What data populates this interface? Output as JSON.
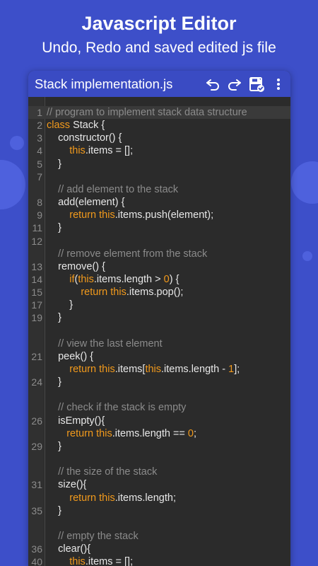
{
  "promo": {
    "title": "Javascript Editor",
    "subtitle": "Undo, Redo and saved edited js file"
  },
  "app_bar": {
    "title": "Stack implementation.js",
    "icons": [
      "undo-icon",
      "redo-icon",
      "save-icon",
      "more-vert-icon"
    ]
  },
  "colors": {
    "background": "#3d4fc9",
    "app_bar": "#3a4bc3",
    "editor_bg": "#2b2b2b",
    "keyword": "#f29a1c",
    "comment": "#8b8b8b",
    "text": "#e8e8e8",
    "line_number": "#8c8c8c"
  },
  "editor": {
    "active_line": 1,
    "lines": [
      {
        "n": "1",
        "tokens": [
          {
            "t": "// program to implement stack data structure",
            "c": "cm"
          }
        ]
      },
      {
        "n": "2",
        "tokens": [
          {
            "t": "class",
            "c": "kw"
          },
          {
            "t": " Stack {",
            "c": "pl"
          }
        ]
      },
      {
        "n": "3",
        "tokens": [
          {
            "t": "    constructor() {",
            "c": "pl"
          }
        ]
      },
      {
        "n": "4",
        "tokens": [
          {
            "t": "        ",
            "c": "pl"
          },
          {
            "t": "this",
            "c": "kw"
          },
          {
            "t": ".items = [];",
            "c": "pl"
          }
        ]
      },
      {
        "n": "5",
        "tokens": [
          {
            "t": "    }",
            "c": "pl"
          }
        ]
      },
      {
        "n": "7",
        "tokens": []
      },
      {
        "n": "",
        "tokens": [
          {
            "t": "    // add element to the stack",
            "c": "cm"
          }
        ]
      },
      {
        "n": "8",
        "tokens": [
          {
            "t": "    add(element) {",
            "c": "pl"
          }
        ]
      },
      {
        "n": "9",
        "tokens": [
          {
            "t": "        ",
            "c": "pl"
          },
          {
            "t": "return",
            "c": "kw"
          },
          {
            "t": " ",
            "c": "pl"
          },
          {
            "t": "this",
            "c": "kw"
          },
          {
            "t": ".items.push(element);",
            "c": "pl"
          }
        ]
      },
      {
        "n": "11",
        "tokens": [
          {
            "t": "    }",
            "c": "pl"
          }
        ]
      },
      {
        "n": "12",
        "tokens": []
      },
      {
        "n": "",
        "tokens": [
          {
            "t": "    // remove element from the stack",
            "c": "cm"
          }
        ]
      },
      {
        "n": "13",
        "tokens": [
          {
            "t": "    remove() {",
            "c": "pl"
          }
        ]
      },
      {
        "n": "14",
        "tokens": [
          {
            "t": "        ",
            "c": "pl"
          },
          {
            "t": "if",
            "c": "kw"
          },
          {
            "t": "(",
            "c": "pl"
          },
          {
            "t": "this",
            "c": "kw"
          },
          {
            "t": ".items.length > ",
            "c": "pl"
          },
          {
            "t": "0",
            "c": "nu"
          },
          {
            "t": ") {",
            "c": "pl"
          }
        ]
      },
      {
        "n": "15",
        "tokens": [
          {
            "t": "            ",
            "c": "pl"
          },
          {
            "t": "return",
            "c": "kw"
          },
          {
            "t": " ",
            "c": "pl"
          },
          {
            "t": "this",
            "c": "kw"
          },
          {
            "t": ".items.pop();",
            "c": "pl"
          }
        ]
      },
      {
        "n": "17",
        "tokens": [
          {
            "t": "        }",
            "c": "pl"
          }
        ]
      },
      {
        "n": "19",
        "tokens": [
          {
            "t": "    }",
            "c": "pl"
          }
        ]
      },
      {
        "n": "",
        "tokens": []
      },
      {
        "n": "",
        "tokens": [
          {
            "t": "    // view the last element",
            "c": "cm"
          }
        ]
      },
      {
        "n": "21",
        "tokens": [
          {
            "t": "    peek() {",
            "c": "pl"
          }
        ]
      },
      {
        "n": "",
        "tokens": [
          {
            "t": "        ",
            "c": "pl"
          },
          {
            "t": "return",
            "c": "kw"
          },
          {
            "t": " ",
            "c": "pl"
          },
          {
            "t": "this",
            "c": "kw"
          },
          {
            "t": ".items[",
            "c": "pl"
          },
          {
            "t": "this",
            "c": "kw"
          },
          {
            "t": ".items.length - ",
            "c": "pl"
          },
          {
            "t": "1",
            "c": "nu"
          },
          {
            "t": "];",
            "c": "pl"
          }
        ]
      },
      {
        "n": "24",
        "tokens": [
          {
            "t": "    }",
            "c": "pl"
          }
        ]
      },
      {
        "n": "",
        "tokens": []
      },
      {
        "n": "",
        "tokens": [
          {
            "t": "    // check if the stack is empty",
            "c": "cm"
          }
        ]
      },
      {
        "n": "26",
        "tokens": [
          {
            "t": "    isEmpty(){",
            "c": "pl"
          }
        ]
      },
      {
        "n": "",
        "tokens": [
          {
            "t": "       ",
            "c": "pl"
          },
          {
            "t": "return",
            "c": "kw"
          },
          {
            "t": " ",
            "c": "pl"
          },
          {
            "t": "this",
            "c": "kw"
          },
          {
            "t": ".items.length == ",
            "c": "pl"
          },
          {
            "t": "0",
            "c": "nu"
          },
          {
            "t": ";",
            "c": "pl"
          }
        ]
      },
      {
        "n": "29",
        "tokens": [
          {
            "t": "    }",
            "c": "pl"
          }
        ]
      },
      {
        "n": "",
        "tokens": []
      },
      {
        "n": "",
        "tokens": [
          {
            "t": "    // the size of the stack",
            "c": "cm"
          }
        ]
      },
      {
        "n": "31",
        "tokens": [
          {
            "t": "    size(){",
            "c": "pl"
          }
        ]
      },
      {
        "n": "",
        "tokens": [
          {
            "t": "        ",
            "c": "pl"
          },
          {
            "t": "return",
            "c": "kw"
          },
          {
            "t": " ",
            "c": "pl"
          },
          {
            "t": "this",
            "c": "kw"
          },
          {
            "t": ".items.length;",
            "c": "pl"
          }
        ]
      },
      {
        "n": "35",
        "tokens": [
          {
            "t": "    }",
            "c": "pl"
          }
        ]
      },
      {
        "n": "",
        "tokens": []
      },
      {
        "n": "",
        "tokens": [
          {
            "t": "    // empty the stack",
            "c": "cm"
          }
        ]
      },
      {
        "n": "36",
        "tokens": [
          {
            "t": "    clear(){",
            "c": "pl"
          }
        ]
      },
      {
        "n": "40",
        "tokens": [
          {
            "t": "        ",
            "c": "pl"
          },
          {
            "t": "this",
            "c": "kw"
          },
          {
            "t": ".items = [];",
            "c": "pl"
          }
        ]
      }
    ]
  }
}
